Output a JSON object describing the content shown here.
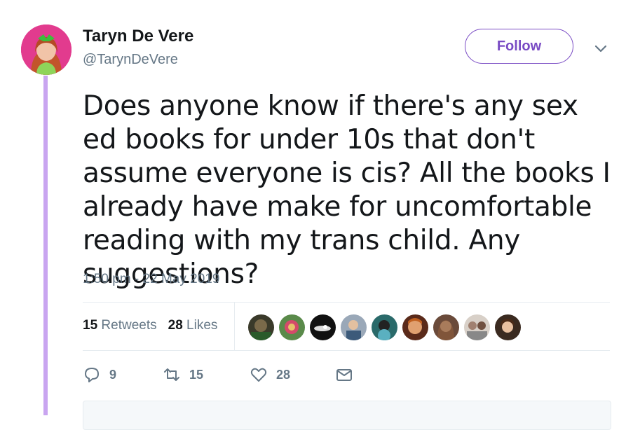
{
  "tweet": {
    "display_name": "Taryn De Vere",
    "handle": "@TarynDeVere",
    "follow_label": "Follow",
    "text": "Does anyone know if there's any sex ed books for under 10s that don't assume everyone is cis? All the books I already have make for uncomfortable reading with my trans child. Any suggestions?",
    "timestamp": "1:50 pm - 22 May 2019"
  },
  "stats": {
    "retweets_count": "15",
    "retweets_label": "Retweets",
    "likes_count": "28",
    "likes_label": "Likes"
  },
  "actions": {
    "reply_count": "9",
    "retweet_count": "15",
    "like_count": "28"
  },
  "colors": {
    "accent": "#794bc4",
    "thread_line": "#c9a5f0",
    "secondary_text": "#657786"
  },
  "icons": [
    "chevron-down-icon",
    "reply-icon",
    "retweet-icon",
    "heart-icon",
    "message-icon"
  ]
}
